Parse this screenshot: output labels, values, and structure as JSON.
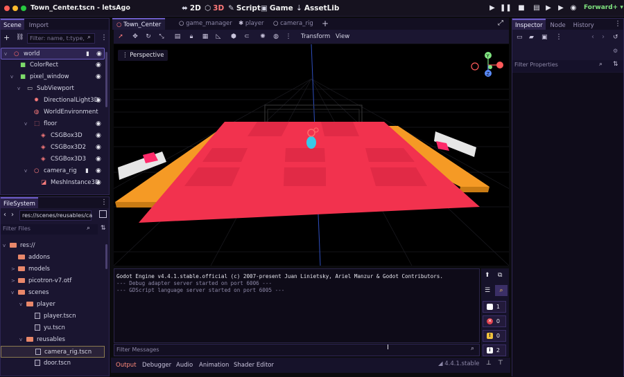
{
  "window": {
    "title": "Town_Center.tscn - letsAgo",
    "renderer": "Forward+"
  },
  "workspaces": [
    {
      "icon": "2d-icon",
      "glyph": "⬌",
      "label": "2D"
    },
    {
      "icon": "3d-icon",
      "glyph": "⬡",
      "label": "3D"
    },
    {
      "icon": "script-icon",
      "glyph": "✎",
      "label": "Script"
    },
    {
      "icon": "game-icon",
      "glyph": "▣",
      "label": "Game"
    },
    {
      "icon": "assetlib-icon",
      "glyph": "⇣",
      "label": "AssetLib"
    }
  ],
  "scene_dock": {
    "tabs": [
      "Scene",
      "Import"
    ],
    "filter_placeholder": "Filter: name, t:type,",
    "nodes": [
      {
        "name": "world",
        "indent": 0,
        "expand": "v",
        "icon": "○",
        "icon_color": "#ff6b6b",
        "script": true,
        "visible": true,
        "selected": true
      },
      {
        "name": "ColorRect",
        "indent": 1,
        "expand": "",
        "icon": "■",
        "icon_color": "#7ddc6a",
        "script": false,
        "visible": true
      },
      {
        "name": "pixel_window",
        "indent": 1,
        "expand": "v",
        "icon": "■",
        "icon_color": "#7ddc6a",
        "script": false,
        "visible": true
      },
      {
        "name": "SubViewport",
        "indent": 2,
        "expand": "v",
        "icon": "▭",
        "icon_color": "#d0d0d0",
        "script": false,
        "visible": false
      },
      {
        "name": "DirectionalLight3D",
        "indent": 3,
        "expand": "",
        "icon": "✹",
        "icon_color": "#ff7d7d",
        "script": false,
        "visible": true
      },
      {
        "name": "WorldEnvironment",
        "indent": 3,
        "expand": "",
        "icon": "◍",
        "icon_color": "#ff7d7d",
        "script": false,
        "visible": false
      },
      {
        "name": "floor",
        "indent": 3,
        "expand": "v",
        "icon": "⬚",
        "icon_color": "#ff7d7d",
        "script": false,
        "visible": true
      },
      {
        "name": "CSGBox3D",
        "indent": 4,
        "expand": "",
        "icon": "◈",
        "icon_color": "#ff7d7d",
        "script": false,
        "visible": true
      },
      {
        "name": "CSGBox3D2",
        "indent": 4,
        "expand": "",
        "icon": "◈",
        "icon_color": "#ff7d7d",
        "script": false,
        "visible": true
      },
      {
        "name": "CSGBox3D3",
        "indent": 4,
        "expand": "",
        "icon": "◈",
        "icon_color": "#ff7d7d",
        "script": false,
        "visible": true
      },
      {
        "name": "camera_rig",
        "indent": 3,
        "expand": "v",
        "icon": "○",
        "icon_color": "#ff7d7d",
        "script": true,
        "visible": true
      },
      {
        "name": "MeshInstance3D",
        "indent": 4,
        "expand": "",
        "icon": "◪",
        "icon_color": "#ff7d7d",
        "script": false,
        "visible": true
      }
    ]
  },
  "filesystem": {
    "tab": "FileSystem",
    "path": "res://scenes/reusables/ca",
    "filter_placeholder": "Filter Files",
    "items": [
      {
        "name": "res://",
        "indent": 0,
        "type": "folder",
        "expand": "v"
      },
      {
        "name": "addons",
        "indent": 1,
        "type": "folder",
        "expand": ""
      },
      {
        "name": "models",
        "indent": 1,
        "type": "folder",
        "expand": ">"
      },
      {
        "name": "picotron-v7.otf",
        "indent": 1,
        "type": "folder",
        "expand": ">"
      },
      {
        "name": "scenes",
        "indent": 1,
        "type": "folder",
        "expand": "v"
      },
      {
        "name": "player",
        "indent": 2,
        "type": "folder",
        "expand": "v"
      },
      {
        "name": "player.tscn",
        "indent": 3,
        "type": "file",
        "expand": ""
      },
      {
        "name": "yu.tscn",
        "indent": 3,
        "type": "file",
        "expand": ""
      },
      {
        "name": "reusables",
        "indent": 2,
        "type": "folder",
        "expand": "v"
      },
      {
        "name": "camera_rig.tscn",
        "indent": 3,
        "type": "file",
        "expand": "",
        "selected": true
      },
      {
        "name": "door.tscn",
        "indent": 3,
        "type": "file",
        "expand": ""
      }
    ]
  },
  "editor_tabs": [
    {
      "label": "Town_Center",
      "icon": "○",
      "active": true
    },
    {
      "label": "game_manager",
      "icon": "○",
      "active": false
    },
    {
      "label": "player",
      "icon": "✱",
      "active": false
    },
    {
      "label": "camera_rig",
      "icon": "○",
      "active": false
    }
  ],
  "viewport": {
    "menu_transform": "Transform",
    "menu_view": "View",
    "perspective_label": "Perspective",
    "gizmo": {
      "y": "Y",
      "z": "Z"
    }
  },
  "console": {
    "lines": [
      {
        "text": "Godot Engine v4.4.1.stable.official (c) 2007-present Juan Linietsky, Ariel Manzur & Godot Contributors.",
        "color": "#e6e6ee"
      },
      {
        "text": "--- Debug adapter server started on port 6006 ---",
        "color": "#8d88a8"
      },
      {
        "text": "--- GDScript language server started on port 6005 ---",
        "color": "#8d88a8"
      }
    ],
    "filter_placeholder": "Filter Messages",
    "counters": [
      {
        "icon": "log-icon",
        "glyph": "!",
        "glyph_color": "#ffffff",
        "bg": "#ffffff",
        "count": "1"
      },
      {
        "icon": "error-icon",
        "glyph": "✕",
        "glyph_color": "#ffffff",
        "bg": "#e0414c",
        "count": "0"
      },
      {
        "icon": "warning-icon",
        "glyph": "!",
        "glyph_color": "#1a1530",
        "bg": "#f0c23c",
        "count": "0"
      },
      {
        "icon": "info-icon",
        "glyph": "i",
        "glyph_color": "#1a1530",
        "bg": "#ffffff",
        "count": "2"
      }
    ]
  },
  "bottom_tabs": [
    "Output",
    "Debugger",
    "Audio",
    "Animation",
    "Shader Editor"
  ],
  "version": "4.4.1.stable",
  "inspector": {
    "tabs": [
      "Inspector",
      "Node",
      "History"
    ],
    "filter_placeholder": "Filter Properties"
  },
  "colors": {
    "accent": "#6c5cc4",
    "floor_red": "#f2324e",
    "floor_orange": "#f59a25",
    "bg": "#0b0b0e"
  }
}
